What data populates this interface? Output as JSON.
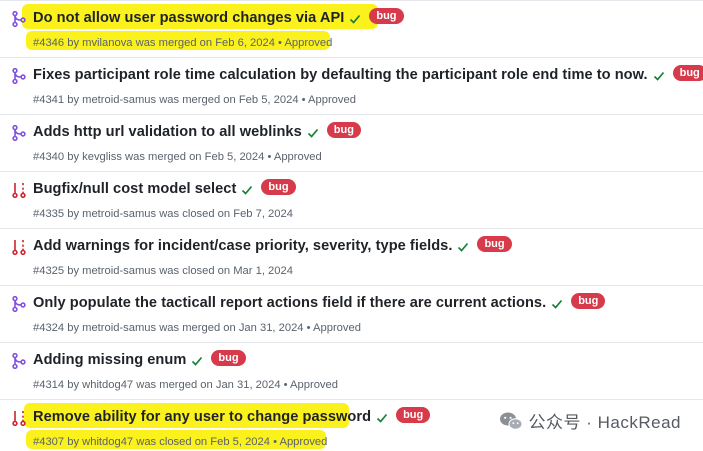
{
  "colors": {
    "merged": "#8250df",
    "closed": "#cf222e",
    "check": "#1a7f37",
    "label_bug": "#d73a4a",
    "highlight": "#fbf11c"
  },
  "pull_requests": [
    {
      "state": "merged",
      "state_icon": "git-merge-icon",
      "title": "Do not allow user password changes via API",
      "check": "✓",
      "label": "bug",
      "meta": "#4346 by mvilanova was merged on Feb 6, 2024 • Approved",
      "highlighted": true
    },
    {
      "state": "merged",
      "state_icon": "git-merge-icon",
      "title": "Fixes participant role time calculation by defaulting the participant role end time to now.",
      "check": "✓",
      "label": "bug",
      "meta": "#4341 by metroid-samus was merged on Feb 5, 2024 • Approved",
      "highlighted": false
    },
    {
      "state": "merged",
      "state_icon": "git-merge-icon",
      "title": "Adds http url validation to all weblinks",
      "check": "✓",
      "label": "bug",
      "meta": "#4340 by kevgliss was merged on Feb 5, 2024 • Approved",
      "highlighted": false
    },
    {
      "state": "closed",
      "state_icon": "git-pull-request-closed-icon",
      "title": "Bugfix/null cost model select",
      "check": "✓",
      "label": "bug",
      "meta": "#4335 by metroid-samus was closed on Feb 7, 2024",
      "highlighted": false
    },
    {
      "state": "closed",
      "state_icon": "git-pull-request-closed-icon",
      "title": "Add warnings for incident/case priority, severity, type fields.",
      "check": "✓",
      "label": "bug",
      "meta": "#4325 by metroid-samus was closed on Mar 1, 2024",
      "highlighted": false
    },
    {
      "state": "merged",
      "state_icon": "git-merge-icon",
      "title": "Only populate the tacticall report actions field if there are current actions.",
      "check": "✓",
      "label": "bug",
      "meta": "#4324 by metroid-samus was merged on Jan 31, 2024 • Approved",
      "highlighted": false
    },
    {
      "state": "merged",
      "state_icon": "git-merge-icon",
      "title": "Adding missing enum",
      "check": "✓",
      "label": "bug",
      "meta": "#4314 by whitdog47 was merged on Jan 31, 2024 • Approved",
      "highlighted": false
    },
    {
      "state": "closed",
      "state_icon": "git-pull-request-closed-icon",
      "title": "Remove ability for any user to change password",
      "check": "✓",
      "label": "bug",
      "meta": "#4307 by whitdog47 was closed on Feb 5, 2024 • Approved",
      "highlighted": true
    }
  ],
  "watermark": {
    "icon": "wechat-icon",
    "text": "公众号 · HackRead"
  }
}
